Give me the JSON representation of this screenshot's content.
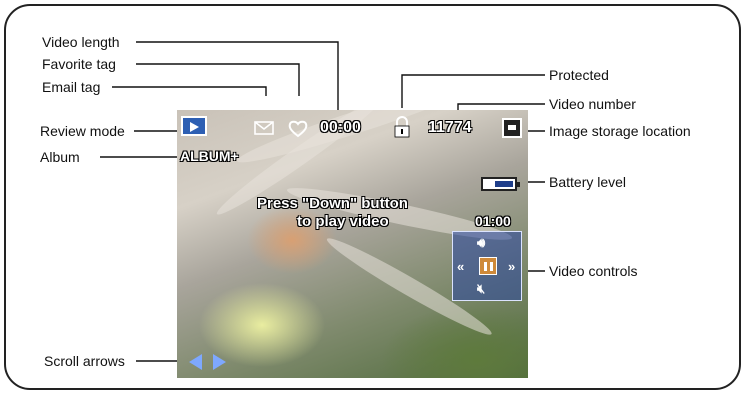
{
  "callouts": {
    "video_length": "Video length",
    "favorite_tag": "Favorite tag",
    "email_tag": "Email tag",
    "review_mode": "Review mode",
    "album": "Album",
    "protected": "Protected",
    "video_number": "Video number",
    "image_storage_location": "Image storage location",
    "battery_level": "Battery level",
    "video_controls": "Video controls",
    "scroll_arrows": "Scroll arrows"
  },
  "screen": {
    "album_label": "ALBUM+",
    "time_display": "00:00",
    "video_number": "11774",
    "message_line1": "Press \"Down\" button",
    "message_line2": "to play video",
    "video_duration": "01:00"
  },
  "icons": [
    "review-mode-icon",
    "email-icon",
    "heart-icon",
    "lock-icon",
    "storage-icon",
    "battery-icon",
    "volume-up-icon",
    "rewind-icon",
    "pause-icon",
    "fast-forward-icon",
    "mute-icon",
    "scroll-left-icon",
    "scroll-right-icon"
  ]
}
